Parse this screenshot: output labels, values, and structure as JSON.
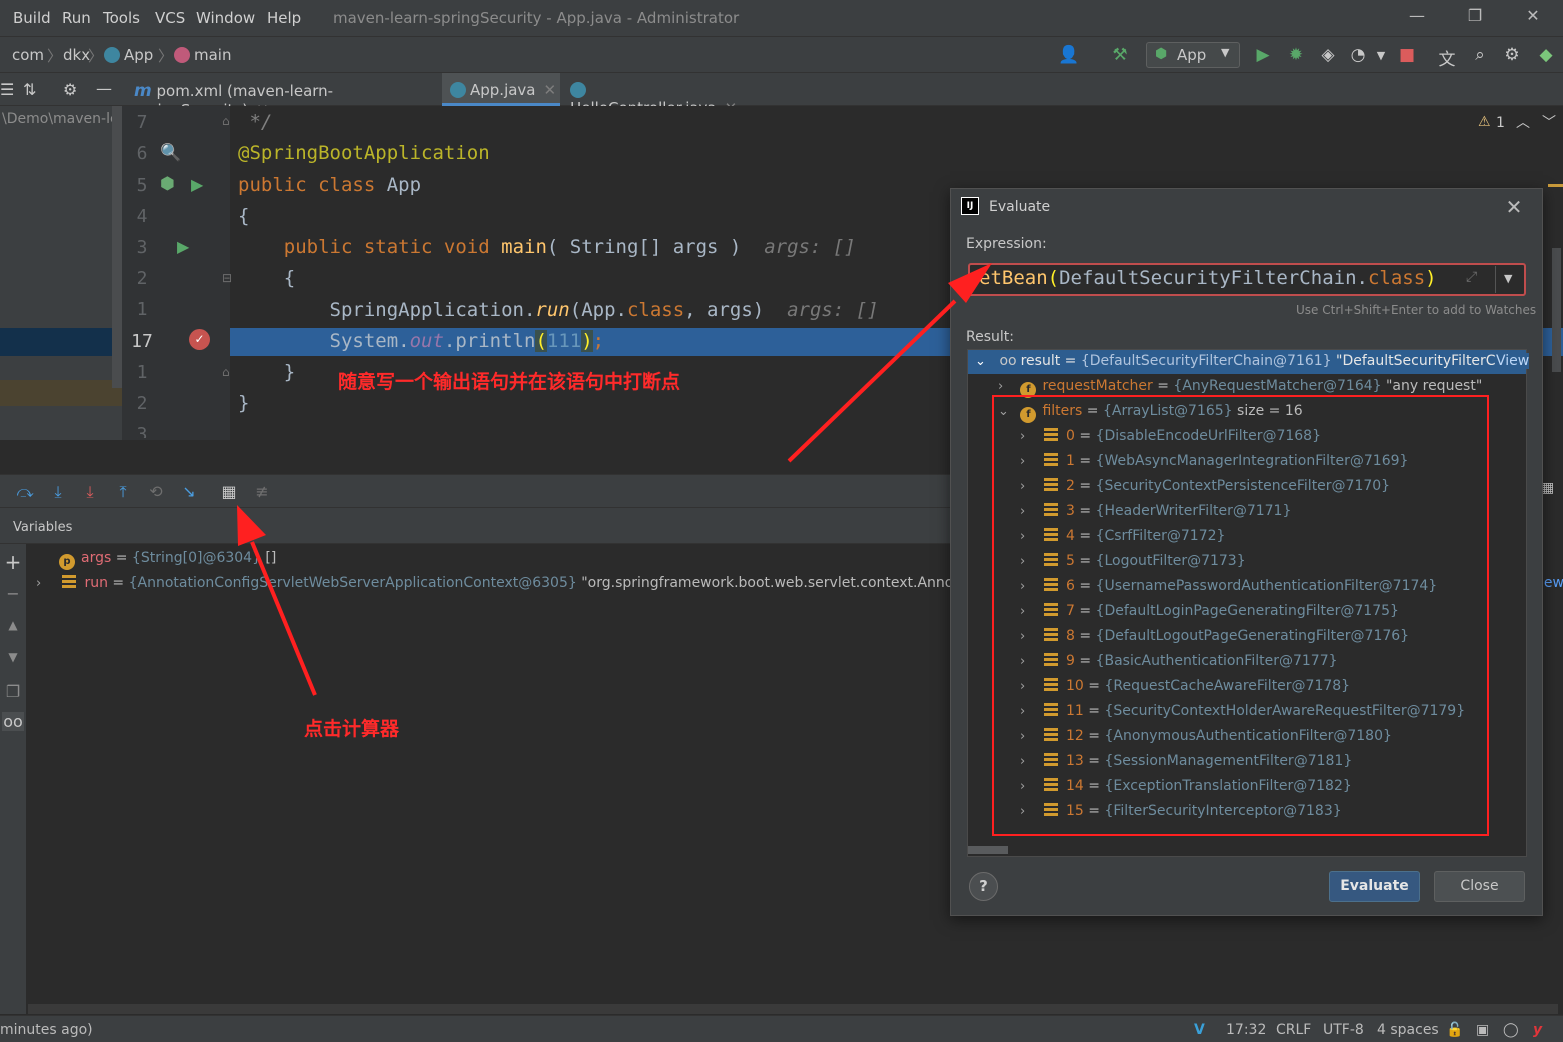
{
  "menubar": {
    "items": [
      {
        "label": "Build",
        "ul": "B"
      },
      {
        "label": "Run",
        "ul": "u"
      },
      {
        "label": "Tools",
        "ul": "T"
      },
      {
        "label": "VCS",
        "ul": "S"
      },
      {
        "label": "Window",
        "ul": "W"
      },
      {
        "label": "Help",
        "ul": "H"
      }
    ],
    "window_title": "maven-learn-springSecurity - App.java - Administrator",
    "minimize": "—",
    "restore": "❐",
    "close": "✕"
  },
  "navbar": {
    "crumbs": [
      "com",
      "dkx",
      "App",
      "main"
    ],
    "run_config": "App"
  },
  "tabs": [
    {
      "label": "pom.xml (maven-learn-springSecurity)",
      "icon": "maven-icon",
      "active": false
    },
    {
      "label": "App.java",
      "icon": "java-class-icon",
      "active": true
    },
    {
      "label": "HelloController.java",
      "icon": "java-class-icon",
      "active": false
    }
  ],
  "project": {
    "path": "\\Demo\\maven-lea"
  },
  "editor": {
    "line_numbers": [
      "7",
      "6",
      "5",
      "4",
      "3",
      "2",
      "1",
      "17",
      "1",
      "2",
      "3"
    ],
    "lines": {
      "l1_comment": " */",
      "l2_annotation": "@SpringBootApplication",
      "l3_public": "public ",
      "l3_class": "class ",
      "l3_name": "App",
      "l4_brace": "{",
      "l5_indent": "    ",
      "l5_public": "public ",
      "l5_static": "static ",
      "l5_void": "void ",
      "l5_main": "main",
      "l5_params": "( String[] args )  ",
      "l5_hint": "args: []",
      "l6_brace": "    {",
      "l7_cls": "        SpringApplication.",
      "l7_run": "run",
      "l7_open": "(App.",
      "l7_class": "class",
      "l7_rest": ", args)  ",
      "l7_hint": "args: []",
      "l8_sys": "        System.",
      "l8_out": "out",
      "l8_println": ".println",
      "l8_open": "(",
      "l8_num": "111",
      "l8_close": ")",
      "l8_semi": ";",
      "l9_brace": "    }",
      "l10_brace": "}"
    },
    "warnings": "1",
    "annotation_note": "随意写一个输出语句并在该语句中打断点"
  },
  "debug": {
    "variables_label": "Variables",
    "vars": [
      {
        "name": "args",
        "eq": " = ",
        "type": "{String[0]@6304}",
        "value": " []"
      },
      {
        "name": "run",
        "eq": " = ",
        "type": "{AnnotationConfigServletWebServerApplicationContext@6305}",
        "value": " \"org.springframework.boot.web.servlet.context.AnnotationCon"
      }
    ],
    "calc_note": "点击计算器",
    "view_link": "iew"
  },
  "evaluate": {
    "title": "Evaluate",
    "expression_label": "Expression:",
    "expression_pre": "etBean",
    "expression_paren": "(",
    "expression_cls": "DefaultSecurityFilterChain.",
    "expression_class": "class",
    "expression_post": ")",
    "hint": "Use Ctrl+Shift+Enter to add to Watches",
    "result_label": "Result:",
    "result_root": {
      "key": "result",
      "eq": " = ",
      "type": "{DefaultSecurityFilterChain@7161}",
      "value": " \"DefaultSecurityFilterChair...",
      "view": "View"
    },
    "request_matcher": {
      "key": "requestMatcher",
      "eq": " = ",
      "type": "{AnyRequestMatcher@7164}",
      "value": " \"any request\""
    },
    "filters": {
      "key": "filters",
      "eq": " = ",
      "type": "{ArrayList@7165}",
      "size": "  size = 16"
    },
    "filter_items": [
      {
        "idx": "0",
        "type": "{DisableEncodeUrlFilter@7168}"
      },
      {
        "idx": "1",
        "type": "{WebAsyncManagerIntegrationFilter@7169}"
      },
      {
        "idx": "2",
        "type": "{SecurityContextPersistenceFilter@7170}"
      },
      {
        "idx": "3",
        "type": "{HeaderWriterFilter@7171}"
      },
      {
        "idx": "4",
        "type": "{CsrfFilter@7172}"
      },
      {
        "idx": "5",
        "type": "{LogoutFilter@7173}"
      },
      {
        "idx": "6",
        "type": "{UsernamePasswordAuthenticationFilter@7174}"
      },
      {
        "idx": "7",
        "type": "{DefaultLoginPageGeneratingFilter@7175}"
      },
      {
        "idx": "8",
        "type": "{DefaultLogoutPageGeneratingFilter@7176}"
      },
      {
        "idx": "9",
        "type": "{BasicAuthenticationFilter@7177}"
      },
      {
        "idx": "10",
        "type": "{RequestCacheAwareFilter@7178}"
      },
      {
        "idx": "11",
        "type": "{SecurityContextHolderAwareRequestFilter@7179}"
      },
      {
        "idx": "12",
        "type": "{AnonymousAuthenticationFilter@7180}"
      },
      {
        "idx": "13",
        "type": "{SessionManagementFilter@7181}"
      },
      {
        "idx": "14",
        "type": "{ExceptionTranslationFilter@7182}"
      },
      {
        "idx": "15",
        "type": "{FilterSecurityInterceptor@7183}"
      }
    ],
    "help": "?",
    "evaluate_button": "Evaluate",
    "close_button": "Close"
  },
  "statusbar": {
    "left": "minutes ago)",
    "position": "17:32",
    "line_sep": "CRLF",
    "encoding": "UTF-8",
    "indent": "4 spaces"
  },
  "colors": {
    "accent": "#4a88c7",
    "annotation_red": "#ff2a2a",
    "exec_line": "#2d6099"
  }
}
